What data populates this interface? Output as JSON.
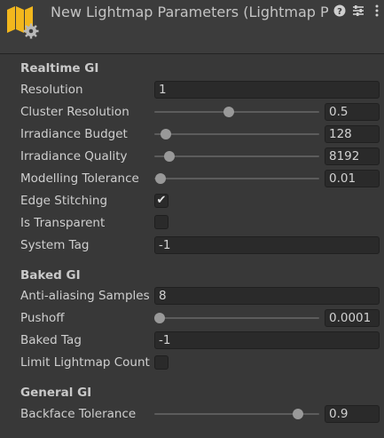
{
  "header": {
    "title": "New Lightmap Parameters (Lightmap Parameters)",
    "icons": [
      "lightmap-asset-icon",
      "help-icon",
      "preset-icon",
      "more-menu-icon"
    ]
  },
  "realtime_gi": {
    "title": "Realtime GI",
    "resolution": {
      "label": "Resolution",
      "value": "1"
    },
    "cluster_resolution": {
      "label": "Cluster Resolution",
      "value": "0.5",
      "slider_level": 0.45
    },
    "irradiance_budget": {
      "label": "Irradiance Budget",
      "value": "128",
      "slider_level": 0.07
    },
    "irradiance_quality": {
      "label": "Irradiance Quality",
      "value": "8192",
      "slider_level": 0.09
    },
    "modelling_tolerance": {
      "label": "Modelling Tolerance",
      "value": "0.01",
      "slider_level": 0.04
    },
    "edge_stitching": {
      "label": "Edge Stitching",
      "checked": true
    },
    "is_transparent": {
      "label": "Is Transparent",
      "checked": false
    },
    "system_tag": {
      "label": "System Tag",
      "value": "-1"
    }
  },
  "baked_gi": {
    "title": "Baked GI",
    "anti_aliasing": {
      "label": "Anti-aliasing Samples",
      "value": "8"
    },
    "pushoff": {
      "label": "Pushoff",
      "value": "0.0001",
      "slider_level": 0.03
    },
    "baked_tag": {
      "label": "Baked Tag",
      "value": "-1"
    },
    "limit_lightmap_count": {
      "label": "Limit Lightmap Count",
      "checked": false
    }
  },
  "general_gi": {
    "title": "General GI",
    "backface_tolerance": {
      "label": "Backface Tolerance",
      "value": "0.9",
      "slider_level": 0.87
    }
  },
  "colors": {
    "background": "#383838",
    "field": "#2a2a2a",
    "icon_yellow": "#f2b71d"
  }
}
